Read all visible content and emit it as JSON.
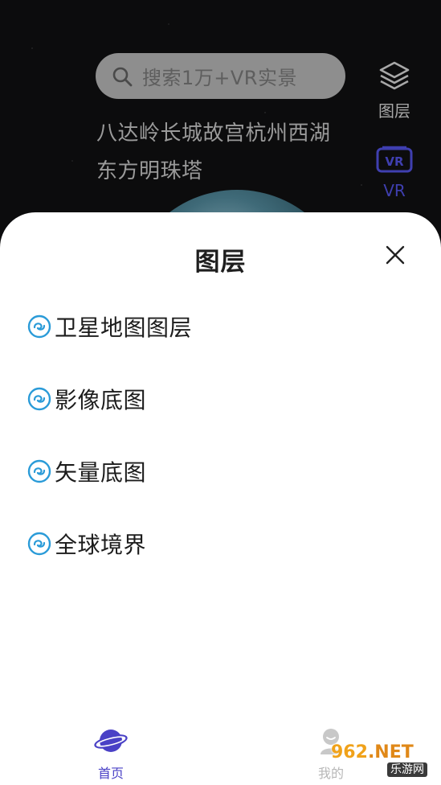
{
  "search": {
    "placeholder": "搜索1万+VR实景"
  },
  "hot_spots": {
    "line1": "八达岭长城故宫杭州西湖",
    "line2": "东方明珠塔"
  },
  "side_buttons": {
    "layers_label": "图层",
    "vr_label": "VR"
  },
  "sheet": {
    "title": "图层",
    "items": [
      {
        "label": "卫星地图图层",
        "icon": "layer-link-icon"
      },
      {
        "label": "影像底图",
        "icon": "layer-link-icon"
      },
      {
        "label": "矢量底图",
        "icon": "layer-link-icon"
      },
      {
        "label": "全球境界",
        "icon": "layer-link-icon"
      }
    ]
  },
  "bottom_nav": {
    "home_label": "首页",
    "me_label": "我的"
  },
  "watermark": {
    "brand": "962",
    "brand_suffix": ".NET",
    "sub": "乐游网"
  },
  "colors": {
    "accent": "#4a41c6",
    "item_icon": "#2a9bd8"
  }
}
